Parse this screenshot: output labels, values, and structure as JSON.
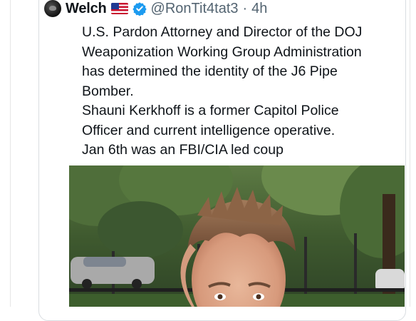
{
  "tweet": {
    "author_name": "Welch",
    "flag_emoji": "🇺🇸",
    "handle": "@RonTit4tat3",
    "separator": "·",
    "time": "4h",
    "lines": [
      "U.S. Pardon Attorney and Director of the DOJ",
      "Weaponization Working Group Administration",
      "has determined the identity of the J6 Pipe",
      "Bomber.",
      "Shauni Kerkhoff is a former Capitol Police",
      "Officer and current intelligence operative.",
      "Jan 6th was an FBI/CIA led coup"
    ]
  },
  "colors": {
    "text": "#0f1419",
    "secondary": "#536471",
    "verified": "#1d9bf0",
    "border": "#d9dde1"
  },
  "icons": [
    "avatar",
    "us-flag-icon",
    "verified-badge-icon"
  ]
}
